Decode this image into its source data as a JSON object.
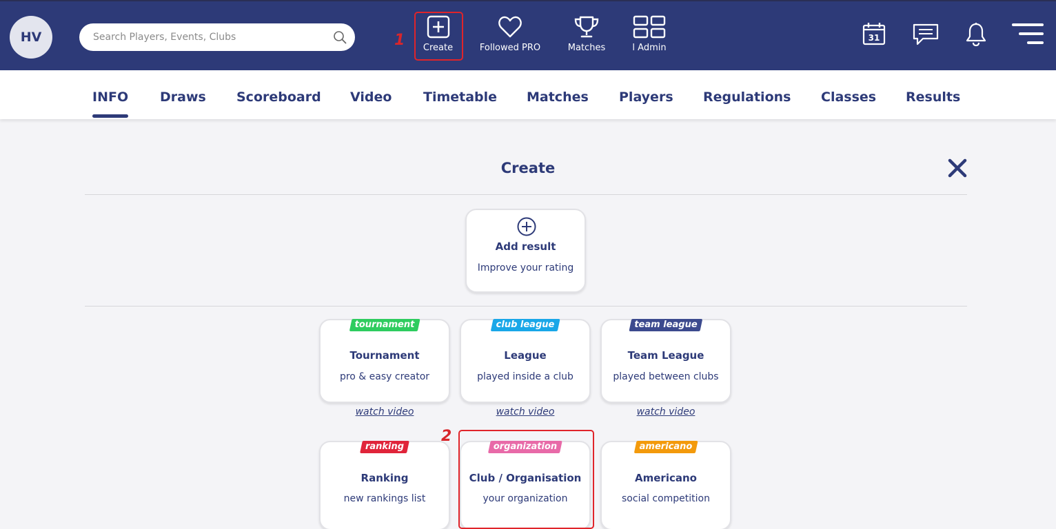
{
  "header": {
    "avatar_initials": "HV",
    "search_placeholder": "Search Players, Events, Clubs",
    "nav": [
      {
        "label": "Create",
        "icon": "plus-square-icon"
      },
      {
        "label": "Followed PRO",
        "icon": "heart-icon"
      },
      {
        "label": "Matches",
        "icon": "trophy-icon"
      },
      {
        "label": "l Admin",
        "icon": "grid-icon"
      }
    ],
    "calendar_day": "31",
    "annotation_1": "1"
  },
  "tabs": [
    "INFO",
    "Draws",
    "Scoreboard",
    "Video",
    "Timetable",
    "Matches",
    "Players",
    "Regulations",
    "Classes",
    "Results"
  ],
  "active_tab": "INFO",
  "create_panel": {
    "title": "Create",
    "add_result": {
      "title": "Add result",
      "subtitle": "Improve your rating"
    },
    "cards": [
      {
        "tag": "tournament",
        "tag_color": "#2ecc5f",
        "title": "Tournament",
        "subtitle": "pro & easy creator",
        "link": "watch video"
      },
      {
        "tag": "club league",
        "tag_color": "#19a7e8",
        "title": "League",
        "subtitle": "played inside a club",
        "link": "watch video"
      },
      {
        "tag": "team league",
        "tag_color": "#3c4a8e",
        "title": "Team League",
        "subtitle": "played between clubs",
        "link": "watch video"
      },
      {
        "tag": "ranking",
        "tag_color": "#e0243a",
        "title": "Ranking",
        "subtitle": "new rankings list"
      },
      {
        "tag": "organization",
        "tag_color": "#e86aa8",
        "title": "Club / Organisation",
        "subtitle": "your organization"
      },
      {
        "tag": "americano",
        "tag_color": "#f39a0c",
        "title": "Americano",
        "subtitle": "social competition"
      }
    ],
    "annotation_2": "2"
  },
  "colors": {
    "brand": "#2d3a78",
    "highlight": "#e0242a",
    "background": "#f4f4f7"
  }
}
